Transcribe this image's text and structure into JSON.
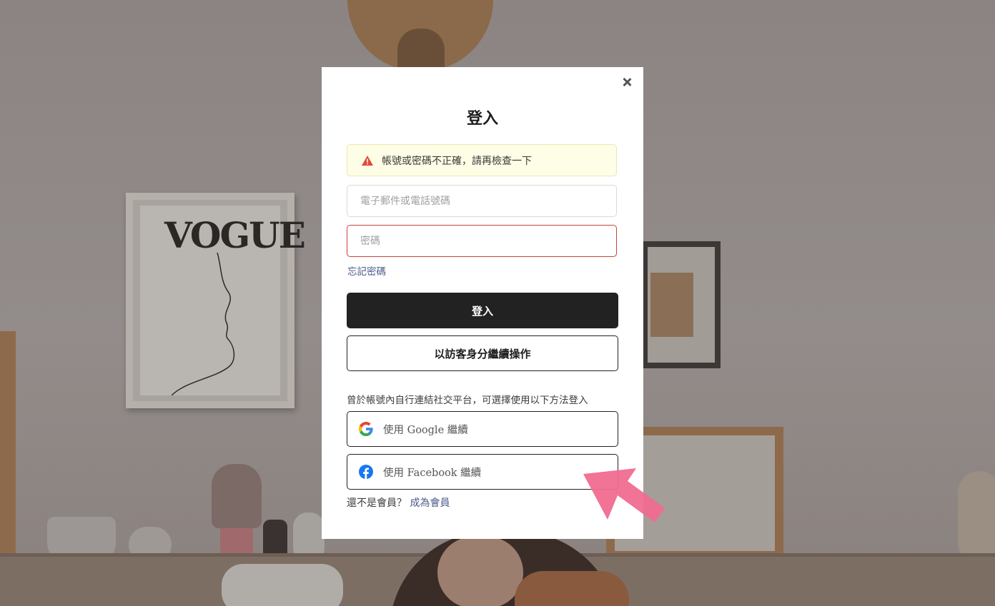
{
  "background": {
    "poster_text": "VOGUE"
  },
  "modal": {
    "close_icon": "close-icon",
    "title": "登入",
    "alert": {
      "icon": "warning-icon",
      "message": "帳號或密碼不正確，請再檢查一下",
      "color": "#e04a3a"
    },
    "email_placeholder": "電子郵件或電話號碼",
    "password_placeholder": "密碼",
    "forgot_password": "忘記密碼",
    "login_button": "登入",
    "guest_button": "以訪客身分繼續操作",
    "social_note": "曾於帳號內自行連結社交平台，可選擇使用以下方法登入",
    "google_button": "使用 Google 繼續",
    "facebook_button": "使用 Facebook 繼續",
    "signup_prompt": "還不是會員？",
    "signup_link": "成為會員"
  },
  "colors": {
    "primary_button": "#222222",
    "error_border": "#c9423b",
    "link": "#4a5a8a",
    "facebook": "#1877f2",
    "arrow": "#f06b8f"
  }
}
